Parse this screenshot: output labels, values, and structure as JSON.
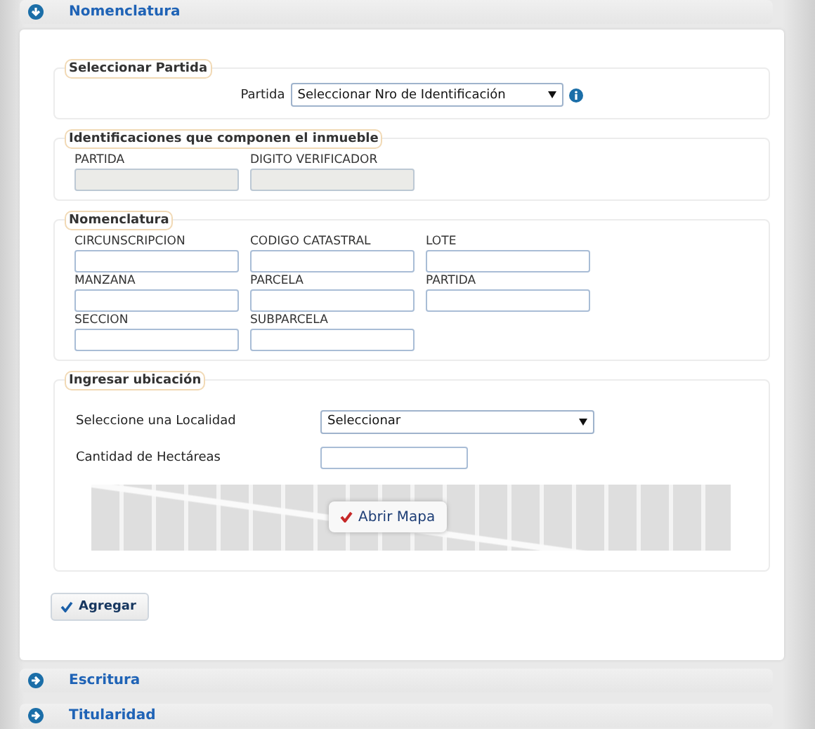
{
  "sections": [
    {
      "title": "Nomenclatura",
      "expanded": true,
      "fieldsets": [
        {
          "kind": "select",
          "legend": "Seleccionar Partida",
          "label": "Partida",
          "value": "Seleccionar Nro de Identificación"
        },
        {
          "kind": "grid",
          "legend": "Identificaciones que componen el inmueble",
          "fields": [
            {
              "label": "PARTIDA",
              "disabled": true
            },
            {
              "label": "DIGITO VERIFICADOR",
              "disabled": true
            }
          ]
        },
        {
          "kind": "grid",
          "legend": "Nomenclatura",
          "fields": [
            {
              "label": "CIRCUNSCRIPCION",
              "disabled": false
            },
            {
              "label": "CODIGO CATASTRAL",
              "disabled": false
            },
            {
              "label": "LOTE",
              "disabled": false
            },
            {
              "label": "MANZANA",
              "disabled": false
            },
            {
              "label": "PARCELA",
              "disabled": false
            },
            {
              "label": "PARTIDA",
              "disabled": false
            },
            {
              "label": "SECCION",
              "disabled": false
            },
            {
              "label": "SUBPARCELA",
              "disabled": false
            }
          ]
        },
        {
          "kind": "location",
          "legend": "Ingresar ubicación",
          "rows": [
            {
              "kind": "select",
              "label": "Seleccione una Localidad",
              "value": "Seleccionar"
            },
            {
              "kind": "input",
              "label": "Cantidad de Hectáreas"
            }
          ],
          "map_button": "Abrir Mapa"
        }
      ],
      "button": "Agregar"
    },
    {
      "title": "Escritura",
      "expanded": false
    },
    {
      "title": "Titularidad",
      "expanded": false
    }
  ]
}
